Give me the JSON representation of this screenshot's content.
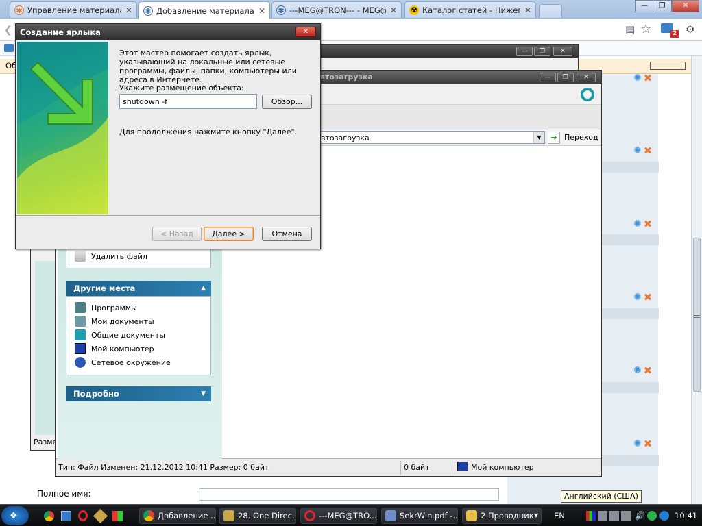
{
  "browser": {
    "tabs": [
      {
        "label": "Управление материалами -",
        "icon": "joomla-icon",
        "active": false
      },
      {
        "label": "Добавление материала - К",
        "icon": "joomla-icon",
        "active": true
      },
      {
        "label": "---MEG@TRON--- - MEG@TR",
        "icon": "joomla-icon",
        "active": false
      },
      {
        "label": "Каталог статей - Нижегор",
        "icon": "radiation-icon",
        "active": false
      }
    ],
    "notification_count": "2"
  },
  "explorer": {
    "title": "втозагрузка",
    "address": "втозагрузка",
    "go_label": "Переход",
    "delete_file": "Удалить файл",
    "other_places": {
      "title": "Другие места",
      "items": [
        "Программы",
        "Мои документы",
        "Общие документы",
        "Мой компьютер",
        "Сетевое окружение"
      ]
    },
    "details_title": "Подробно",
    "status_left": "Тип: Файл Изменен: 21.12.2012 10:41 Размер: 0 байт",
    "status_size": "0 байт",
    "status_location": "Мой компьютер",
    "back_window_status": "Разме"
  },
  "wizard": {
    "title": "Создание ярлыка",
    "description": "Этот мастер помогает создать ярлык, указывающий на локальные или сетевые программы, файлы, папки, компьютеры или адреса в Интернете.",
    "location_label": "Укажите размещение объекта:",
    "location_value": "shutdown -f",
    "browse_label": "Обзор...",
    "continue_text": "Для продолжения нажмите кнопку \"Далее\".",
    "back_label": "< Назад",
    "next_label": "Далее >",
    "cancel_label": "Отмена"
  },
  "page": {
    "fullname_label": "Полное имя:",
    "tooltip": "Английский (США)",
    "side_label": "Об"
  },
  "taskbar": {
    "tasks": [
      {
        "label": "Добавление ...",
        "icon": "chrome-icon"
      },
      {
        "label": "28. One Direc...",
        "icon": "media-icon"
      },
      {
        "label": "---MEG@TRO...",
        "icon": "opera-icon"
      },
      {
        "label": "SekrWin.pdf -...",
        "icon": "pdf-icon"
      },
      {
        "label": "2 Проводник",
        "icon": "folder-icon"
      }
    ],
    "lang": "EN",
    "clock": "10:41"
  },
  "colors": {
    "accent_orange": "#e08a2e",
    "taskpane_header": "#1d5f87",
    "wizard_titlebar": "#2c2c2c"
  }
}
